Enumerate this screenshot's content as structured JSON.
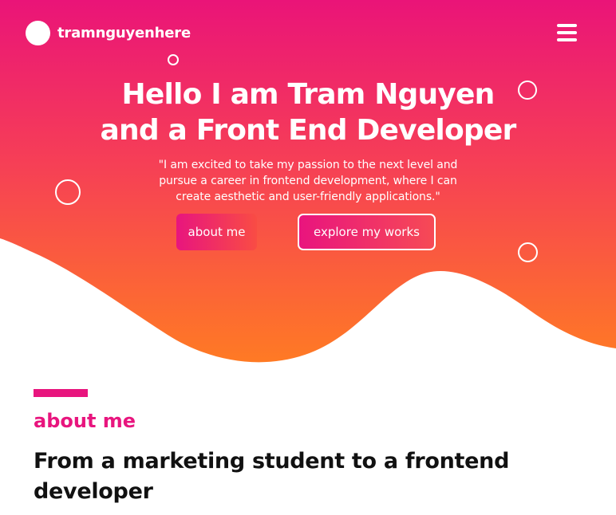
{
  "header": {
    "logo_text": "tramnguyenhere",
    "menu_icon": "hamburger-menu-icon"
  },
  "hero": {
    "title_line1": "Hello I am Tram Nguyen",
    "title_line2": "and a Front End Developer",
    "quote_line1": "\"I am excited to take my passion to the next level and",
    "quote_line2": "pursue a career in frontend development, where I can",
    "quote_line3": "create aesthetic and user-friendly applications.\"",
    "about_button": "about me",
    "works_button": "explore my works"
  },
  "about": {
    "label": "about me",
    "heading_line1": "From a marketing student to a frontend",
    "heading_line2": "developer"
  },
  "colors": {
    "gradient_top": "#ea1478",
    "gradient_bottom": "#ff7a24",
    "accent": "#e8157e",
    "heading_text": "#111111"
  }
}
